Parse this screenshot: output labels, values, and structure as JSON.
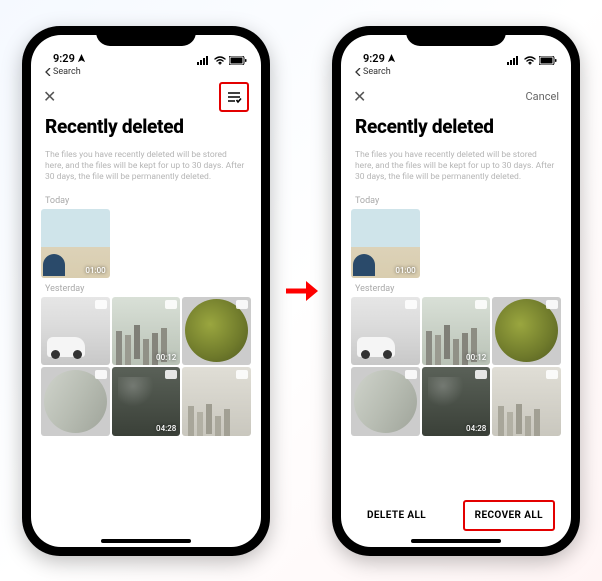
{
  "status": {
    "time": "9:29",
    "back_label": "Search"
  },
  "left": {
    "title": "Recently deleted",
    "desc": "The files you have recently deleted will be stored here, and the files will be kept for up to 30 days. After 30 days, the file will be permanently deleted.",
    "section_today": "Today",
    "section_yesterday": "Yesterday",
    "thumbs": {
      "today": [
        {
          "duration": "01:00"
        }
      ],
      "yesterday": [
        {
          "duration": ""
        },
        {
          "duration": "00:12"
        },
        {
          "duration": ""
        },
        {
          "duration": ""
        },
        {
          "duration": "04:28"
        },
        {
          "duration": ""
        }
      ]
    }
  },
  "right": {
    "cancel": "Cancel",
    "title": "Recently deleted",
    "desc": "The files you have recently deleted will be stored here, and the files will be kept for up to 30 days. After 30 days, the file will be permanently deleted.",
    "section_today": "Today",
    "section_yesterday": "Yesterday",
    "delete_all": "DELETE ALL",
    "recover_all": "RECOVER ALL",
    "thumbs": {
      "today": [
        {
          "duration": "01:00"
        }
      ],
      "yesterday": [
        {
          "duration": ""
        },
        {
          "duration": "00:12"
        },
        {
          "duration": ""
        },
        {
          "duration": ""
        },
        {
          "duration": "04:28"
        },
        {
          "duration": ""
        }
      ]
    }
  }
}
